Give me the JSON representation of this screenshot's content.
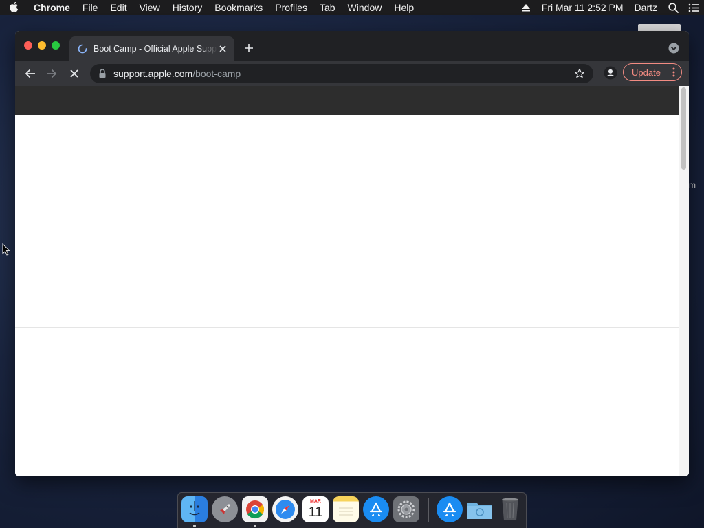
{
  "menubar": {
    "app_name": "Chrome",
    "items": [
      "File",
      "Edit",
      "View",
      "History",
      "Bookmarks",
      "Profiles",
      "Tab",
      "Window",
      "Help"
    ],
    "datetime": "Fri Mar 11  2:52 PM",
    "user": "Dartz",
    "icons": [
      "apple-icon",
      "eject-icon",
      "spotlight-search-icon",
      "control-center-icon"
    ]
  },
  "desktop": {
    "label_fragment": "m"
  },
  "browser": {
    "tab": {
      "title": "Boot Camp - Official Apple Support",
      "loading": true
    },
    "address": {
      "host": "support.apple.com",
      "path": "/boot-camp"
    },
    "update_label": "Update",
    "colors": {
      "frame": "#202124",
      "toolbar": "#35363a",
      "update_accent": "#f28b82"
    }
  },
  "page": {
    "header_color": "#2d2d2d",
    "scroll_position": 0
  },
  "dock": {
    "apps": [
      "Finder",
      "Launchpad",
      "Google Chrome",
      "Safari",
      "Calendar",
      "Notes",
      "App Store",
      "System Preferences"
    ],
    "others": [
      "App Store",
      "Downloads",
      "Trash"
    ],
    "calendar_month": "MAR",
    "calendar_day": "11",
    "running": [
      "Finder",
      "Google Chrome"
    ]
  }
}
